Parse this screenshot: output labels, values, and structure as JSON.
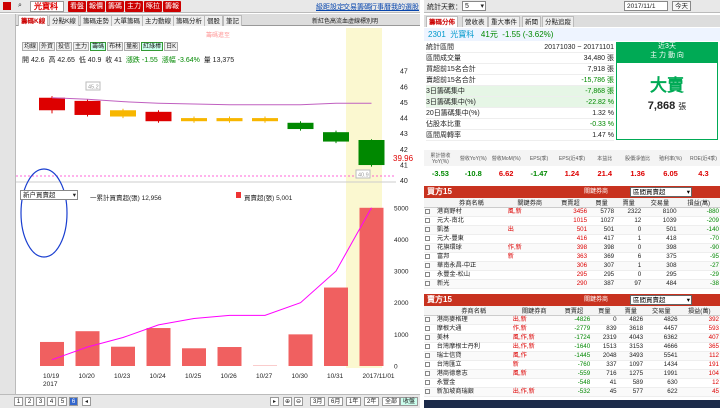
{
  "top": {
    "stock_box": "光寶科",
    "buttons": [
      "看盤",
      "報價",
      "籌碼",
      "主力",
      "啄拉",
      "籌報"
    ],
    "links": [
      "級距設定",
      "交易籌碼",
      "行事曆",
      "我的選股"
    ]
  },
  "tabs": [
    "籌碼K線",
    "分點K線",
    "籌碼走勢",
    "大單籌碼",
    "主力動線",
    "籌碼分析",
    "個股",
    "筆記"
  ],
  "chart_note": "新紅色高流血虛線標別明",
  "subtitle": "籌碼進至",
  "buttons_row": [
    "均線",
    "外資",
    "投信",
    "主力",
    "籌碼",
    "布林",
    "量能",
    "紅綠棒",
    "日K"
  ],
  "quote": {
    "open": "開 42.6",
    "high": "高 42.65",
    "low": "低 40.9",
    "close": "收 41",
    "chg": "漲跌 -1.55",
    "pct": "漲幅 -3.64%",
    "vol": "量 13,375"
  },
  "price_axis": [
    "47",
    "46",
    "45",
    "44",
    "43",
    "42",
    "41",
    "40"
  ],
  "price_current": "39.96",
  "price_high_label": "45.2",
  "price_low_label": "40.9",
  "vol_axis": [
    "5000",
    "4000",
    "3000",
    "2000",
    "1000",
    "0"
  ],
  "lower": {
    "select": "新户買賣超",
    "legend1": "一累計買賣超(張) 12,956",
    "legend2": "買賣超(張) 5,001"
  },
  "dates": [
    "10/19\n2017",
    "10/20",
    "10/23",
    "10/24",
    "10/25",
    "10/26",
    "10/27",
    "10/30",
    "10/31",
    "2017/11/01"
  ],
  "candles": [
    {
      "o": 45.3,
      "c": 44.5,
      "h": 45.4,
      "l": 44.3
    },
    {
      "o": 45.1,
      "c": 44.2,
      "h": 45.2,
      "l": 44.1
    },
    {
      "o": 44.5,
      "c": 44.1,
      "h": 44.6,
      "l": 44.0
    },
    {
      "o": 44.4,
      "c": 43.8,
      "h": 44.5,
      "l": 43.7
    },
    {
      "o": 44.0,
      "c": 43.8,
      "h": 44.1,
      "l": 43.7
    },
    {
      "o": 44.0,
      "c": 43.8,
      "h": 44.1,
      "l": 43.7
    },
    {
      "o": 44.0,
      "c": 43.8,
      "h": 44.1,
      "l": 43.7
    },
    {
      "o": 43.7,
      "c": 43.3,
      "h": 43.8,
      "l": 43.2
    },
    {
      "o": 43.1,
      "c": 42.5,
      "h": 43.2,
      "l": 42.4
    },
    {
      "o": 42.6,
      "c": 41.0,
      "h": 42.65,
      "l": 40.9
    }
  ],
  "candle_colors": [
    "#d00",
    "#d00",
    "#f7b600",
    "#d00",
    "#f7b600",
    "#f7b600",
    "#f7b600",
    "#080",
    "#080",
    "#080"
  ],
  "chart_data": {
    "type": "bar",
    "categories": [
      "10/19",
      "10/20",
      "10/23",
      "10/24",
      "10/25",
      "10/26",
      "10/27",
      "10/30",
      "10/31",
      "11/01"
    ],
    "series": [
      {
        "name": "買賣超(張)",
        "values": [
          760,
          1100,
          610,
          1200,
          560,
          600,
          10,
          1000,
          2480,
          5001
        ]
      },
      {
        "name": "累計買賣超(張)",
        "values": [
          200,
          600,
          900,
          1300,
          1500,
          1600,
          1600,
          2000,
          3000,
          5001
        ]
      }
    ],
    "ylim": [
      0,
      5500
    ]
  },
  "page_buttons": [
    "1",
    "2",
    "3",
    "4",
    "5",
    "6"
  ],
  "range_buttons": [
    "3月",
    "6月",
    "1年",
    "2年",
    "全部",
    "收盤"
  ],
  "right": {
    "top_label": "統計天數：",
    "top_select": "5",
    "date": "2017/11/1",
    "today": "今天",
    "tabs": [
      "籌碼分佈",
      "營收表",
      "重大事件",
      "新聞",
      "分點追蹤"
    ],
    "code": "2301",
    "name": "光寶科",
    "price": "41元",
    "change": "-1.55 (-3.62%)",
    "rows": [
      {
        "k": "統計區間",
        "v": "20171030 ~ 20171101"
      },
      {
        "k": "區間成交量",
        "v": "34,480 張"
      },
      {
        "k": "買超前15名合計",
        "v": "7,918 張"
      },
      {
        "k": "賣超前15名合計",
        "v": "-15,786 張"
      },
      {
        "k": "3日籌碼集中",
        "v": "-7,868 張"
      },
      {
        "k": "3日籌碼集中(%)",
        "v": "-22.82 %"
      },
      {
        "k": "20日籌碼集中(%)",
        "v": "1.32 %"
      },
      {
        "k": "佔股本比重",
        "v": "-0.33 %"
      },
      {
        "k": "區間周轉率",
        "v": "1.47 %"
      }
    ],
    "box_title": "近3天",
    "box_sub": "主 力 動 向",
    "box_big": "大賣",
    "box_num": "7,868",
    "box_unit": "張",
    "sum_heads": [
      "累計營收YoY(%)",
      "營收YoY(%)",
      "營收MoM(%)",
      "EPS(季)",
      "EPS(近4季)",
      "本益比",
      "股價淨值比",
      "殖利率(%)",
      "ROE(近4季)"
    ],
    "sum_vals": [
      "-3.53",
      "-10.8",
      "6.62",
      "-1.47",
      "1.24",
      "21.4",
      "1.36",
      "6.05",
      "4.3"
    ],
    "buy_title": "買方15",
    "sell_title": "賣方15",
    "filter_label": "關鍵券商",
    "filter_select": "區間買賣超",
    "head": [
      "券商名稱",
      "關鍵券商",
      "買賣超",
      "買量",
      "賣量",
      "交易量",
      "損益(萬)"
    ],
    "buy_rows": [
      [
        "港商野村",
        "風,新",
        "3456",
        "5778",
        "2322",
        "8100",
        "-880"
      ],
      [
        "元大-南北",
        "",
        "1015",
        "1027",
        "12",
        "1039",
        "-209"
      ],
      [
        "凱基",
        "出",
        "501",
        "501",
        "0",
        "501",
        "-140"
      ],
      [
        "元大-豐東",
        "",
        "416",
        "417",
        "1",
        "418",
        "-70"
      ],
      [
        "花旗環球",
        "作,新",
        "398",
        "398",
        "0",
        "398",
        "-90"
      ],
      [
        "富邦",
        "新",
        "363",
        "369",
        "6",
        "375",
        "-95"
      ],
      [
        "華南永昌-中正",
        "",
        "306",
        "307",
        "1",
        "308",
        "-27"
      ],
      [
        "永豐金-松山",
        "",
        "295",
        "295",
        "0",
        "295",
        "-29"
      ],
      [
        "新光",
        "",
        "290",
        "387",
        "97",
        "484",
        "-38"
      ]
    ],
    "sell_rows": [
      [
        "港商麥格理",
        "出,新",
        "-4826",
        "0",
        "4826",
        "4826",
        "392"
      ],
      [
        "摩根大通",
        "作,新",
        "-2779",
        "839",
        "3618",
        "4457",
        "593"
      ],
      [
        "美林",
        "風,作,新",
        "-1724",
        "2319",
        "4043",
        "6362",
        "407"
      ],
      [
        "台灣摩根士丹利",
        "出,作,新",
        "-1640",
        "1513",
        "3153",
        "4666",
        "365"
      ],
      [
        "瑞士信貸",
        "風,作",
        "-1445",
        "2048",
        "3493",
        "5541",
        "112"
      ],
      [
        "台灣匯立",
        "新",
        "-760",
        "337",
        "1097",
        "1434",
        "191"
      ],
      [
        "港商德意志",
        "風,新",
        "-559",
        "716",
        "1275",
        "1991",
        "104"
      ],
      [
        "永豐金",
        "",
        "-548",
        "41",
        "589",
        "630",
        "12"
      ],
      [
        "新加坡商瑞銀",
        "出,作,新",
        "-532",
        "45",
        "577",
        "622",
        "45"
      ]
    ]
  }
}
